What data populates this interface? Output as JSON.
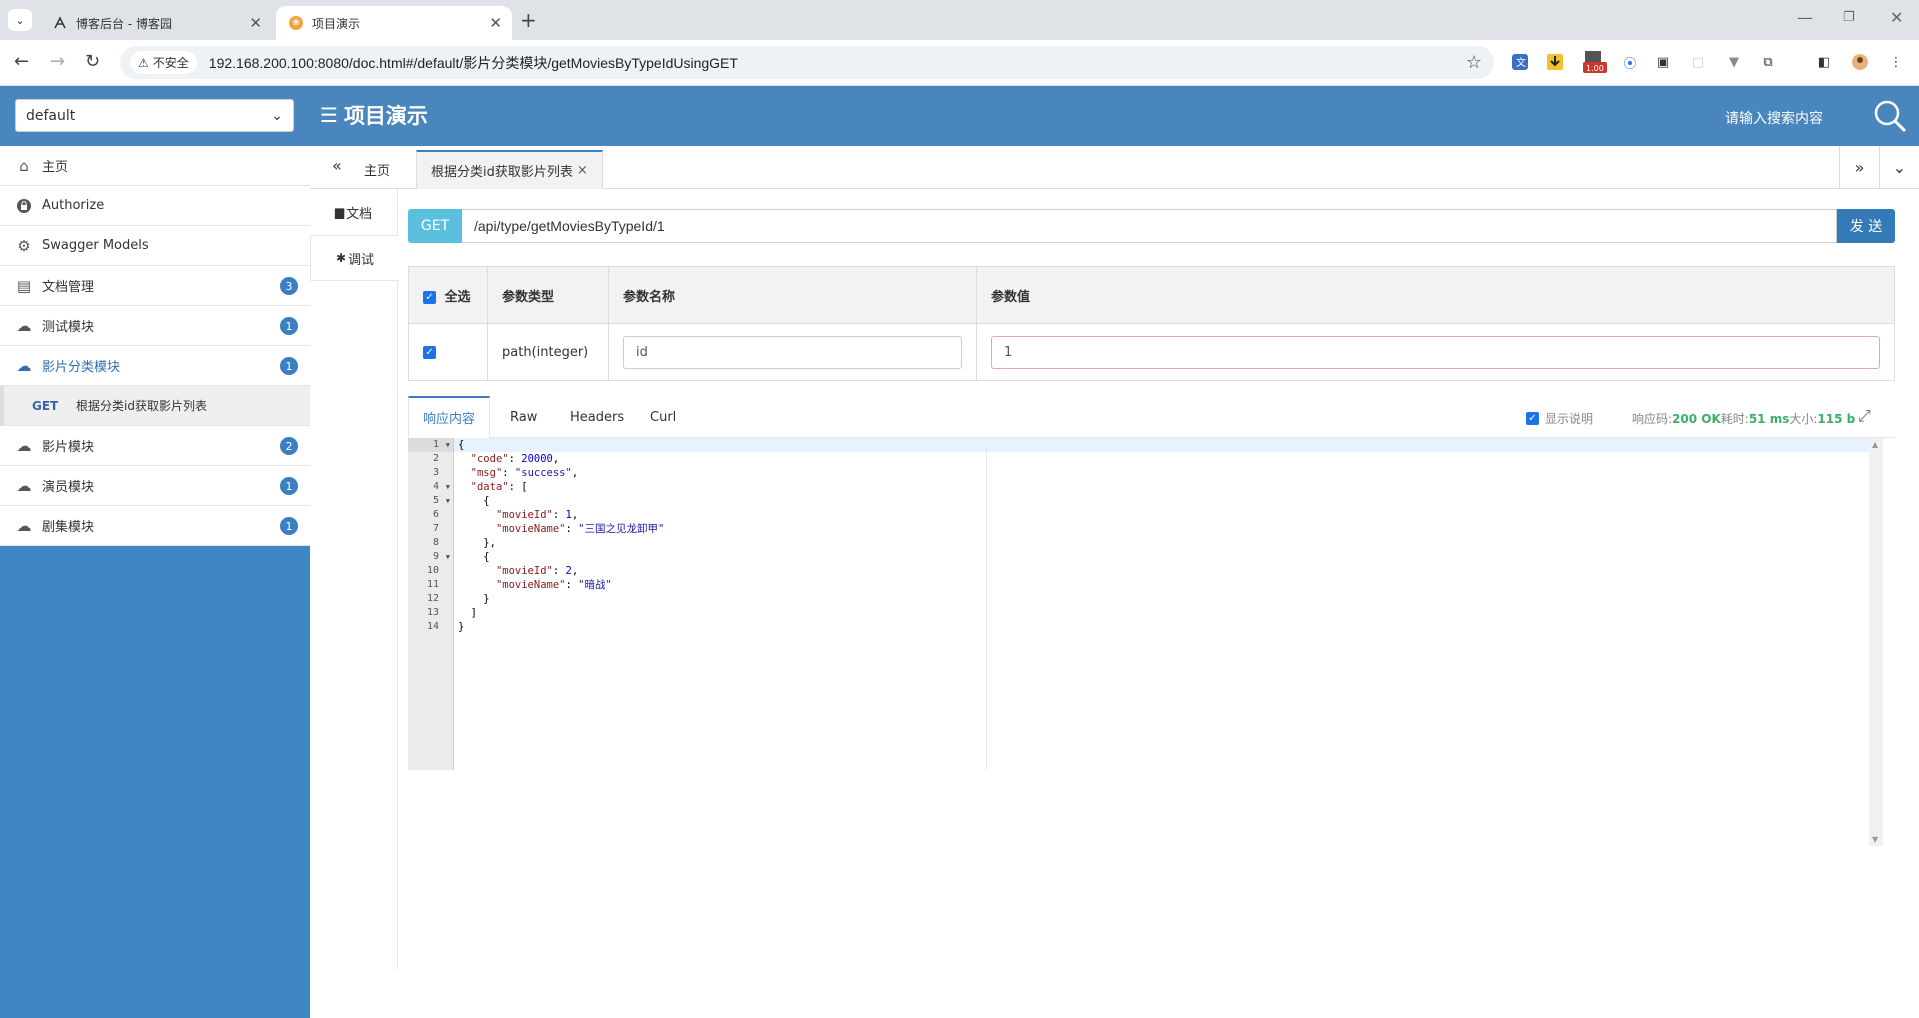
{
  "browser": {
    "tabs": [
      {
        "title": "博客后台 - 博客园",
        "active": false
      },
      {
        "title": "项目演示",
        "active": true
      }
    ],
    "url": "192.168.200.100:8080/doc.html#/default/影片分类模块/getMoviesByTypeIdUsingGET",
    "security_label": "不安全",
    "extension_badge": "1.00"
  },
  "header": {
    "group_select": "default",
    "title": "项目演示",
    "search_placeholder": "请输入搜索内容"
  },
  "sidebar": {
    "items": [
      {
        "label": "主页",
        "icon": "home-icon",
        "badge": null
      },
      {
        "label": "Authorize",
        "icon": "lock-icon",
        "badge": null
      },
      {
        "label": "Swagger Models",
        "icon": "models-icon",
        "badge": null
      },
      {
        "label": "文档管理",
        "icon": "document-icon",
        "badge": "3"
      },
      {
        "label": "测试模块",
        "icon": "cloud-icon",
        "badge": "1"
      },
      {
        "label": "影片分类模块",
        "icon": "cloud-icon",
        "badge": "1",
        "active": true
      },
      {
        "label": "影片模块",
        "icon": "cloud-icon",
        "badge": "2"
      },
      {
        "label": "演员模块",
        "icon": "cloud-icon",
        "badge": "1"
      },
      {
        "label": "剧集模块",
        "icon": "cloud-icon",
        "badge": "1"
      }
    ],
    "sub_item": {
      "method": "GET",
      "label": "根据分类id获取影片列表"
    }
  },
  "content_tabs": {
    "home": "主页",
    "api": "根据分类id获取影片列表"
  },
  "left_nav": {
    "doc": "文档",
    "debug": "调试"
  },
  "request": {
    "method": "GET",
    "path": "/api/type/getMoviesByTypeId/1",
    "send": "发 送"
  },
  "params": {
    "headers": [
      "全选",
      "参数类型",
      "参数名称",
      "参数值"
    ],
    "rows": [
      {
        "type": "path(integer)",
        "name": "id",
        "value": "1"
      }
    ]
  },
  "response": {
    "tabs": [
      "响应内容",
      "Raw",
      "Headers",
      "Curl"
    ],
    "show_desc_label": "显示说明",
    "status_label": "响应码:",
    "status_value": "200 OK",
    "time_label": "耗时:",
    "time_value": "51 ms",
    "size_label": "大小:",
    "size_value": "115 b",
    "line_numbers": [
      "1",
      "2",
      "3",
      "4",
      "5",
      "6",
      "7",
      "8",
      "9",
      "10",
      "11",
      "12",
      "13",
      "14"
    ]
  },
  "colors": {
    "header_bg": "#4a86be",
    "sidebar_bg": "#3e86c4",
    "method_bg": "#5bc0de",
    "send_bg": "#337ab7",
    "status_green": "#3ab066"
  }
}
